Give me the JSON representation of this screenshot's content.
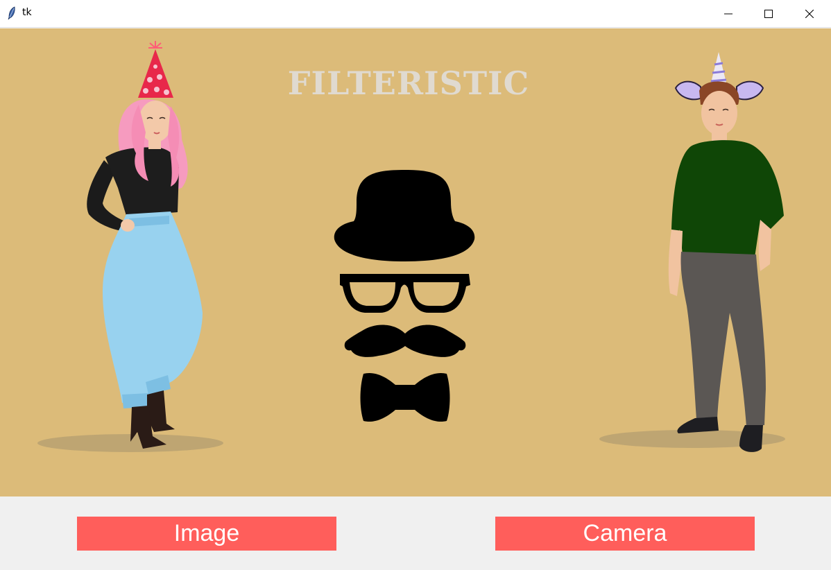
{
  "window": {
    "title": "tk",
    "icons": [
      "feather-icon",
      "minimize-icon",
      "maximize-icon",
      "close-icon"
    ]
  },
  "header": {
    "title": "FILTERISTIC"
  },
  "illustrations": [
    "woman-with-party-hat",
    "filter-props",
    "man-with-unicorn-hat"
  ],
  "buttons": {
    "image_label": "Image",
    "camera_label": "Camera"
  },
  "colors": {
    "background": "#dcbb79",
    "button": "#ff5e5b",
    "title": "#e0dad0"
  }
}
